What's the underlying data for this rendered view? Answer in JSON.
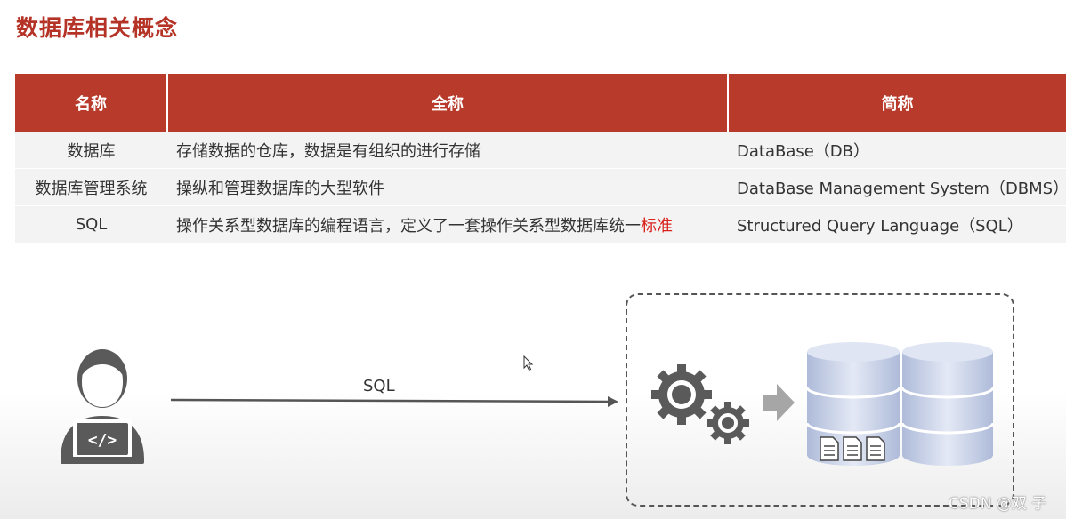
{
  "title": "数据库相关概念",
  "table": {
    "headers": [
      "名称",
      "全称",
      "简称"
    ],
    "rows": [
      {
        "name": "数据库",
        "full": "存储数据的仓库，数据是有组织的进行存储",
        "abbr": "DataBase（DB）"
      },
      {
        "name": "数据库管理系统",
        "full": "操纵和管理数据库的大型软件",
        "abbr": "DataBase Management System（DBMS）"
      },
      {
        "name": "SQL",
        "full": "操作关系型数据库的编程语言，定义了一套操作关系型数据库统一",
        "full_highlight": "标准",
        "abbr": "Structured Query Language（SQL）"
      }
    ]
  },
  "diagram": {
    "arrow_label": "SQL"
  },
  "watermark": "CSDN @双 子",
  "colors": {
    "title": "#b53326",
    "header_bg": "#b83a2b",
    "row_bg": "#f3f3f3",
    "highlight": "#d9231c",
    "icon_gray": "#5a5a5a",
    "db_blue": "#c9d3ea"
  }
}
